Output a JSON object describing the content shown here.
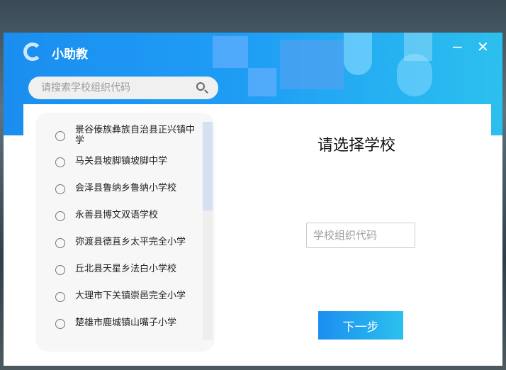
{
  "app": {
    "title": "小助教",
    "minimize": "−",
    "close": "✕"
  },
  "search": {
    "placeholder": "请搜索学校组织代码"
  },
  "schools": [
    "景谷傣族彝族自治县正兴镇中学",
    "马关县坡脚镇坡脚中学",
    "会泽县鲁纳乡鲁纳小学校",
    "永善县博文双语学校",
    "弥渡县德苴乡太平完全小学",
    "丘北县天星乡法白小学校",
    "大理市下关镇崇邑完全小学",
    "楚雄市鹿城镇山嘴子小学"
  ],
  "main": {
    "heading": "请选择学校",
    "code_placeholder": "学校组织代码",
    "next_label": "下一步"
  }
}
